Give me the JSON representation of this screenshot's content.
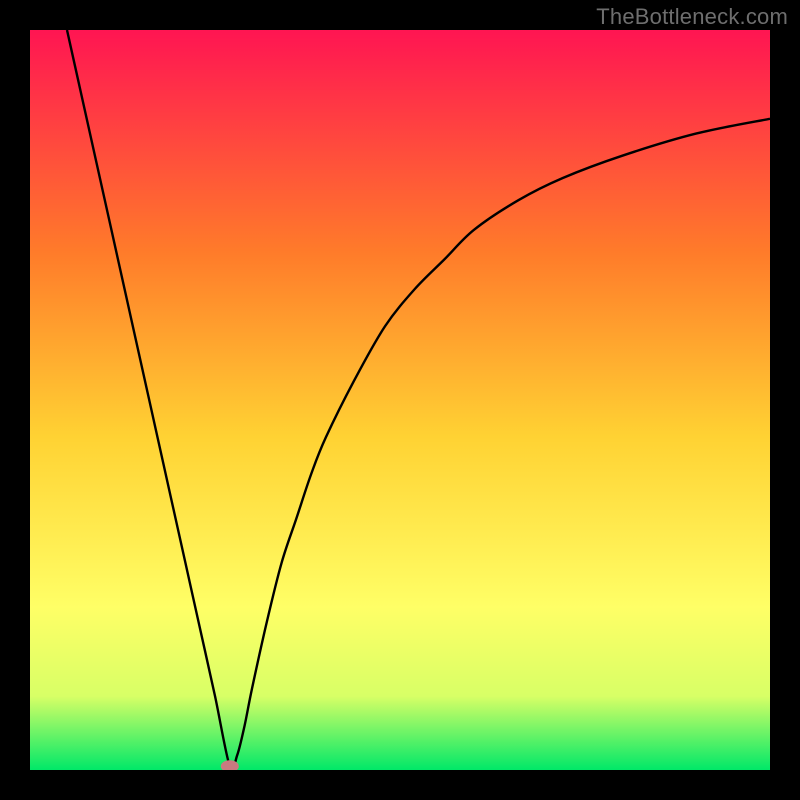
{
  "watermark": "TheBottleneck.com",
  "chart_data": {
    "type": "line",
    "title": "",
    "xlabel": "",
    "ylabel": "",
    "xlim": [
      0,
      100
    ],
    "ylim": [
      0,
      100
    ],
    "background_gradient": {
      "top": "#FF1552",
      "mid_upper": "#FF7B2A",
      "mid": "#FFD233",
      "mid_lower": "#FFFF66",
      "lower": "#D8FF66",
      "bottom": "#00E868"
    },
    "curve_color": "#000000",
    "marker": {
      "x": 27,
      "y": 0.5,
      "color": "#C97A80"
    },
    "series": [
      {
        "name": "bottleneck-curve",
        "x": [
          5,
          7,
          9,
          11,
          13,
          15,
          17,
          19,
          21,
          23,
          25,
          27,
          28,
          29,
          30,
          32,
          34,
          36,
          38,
          40,
          44,
          48,
          52,
          56,
          60,
          66,
          72,
          80,
          90,
          100
        ],
        "y": [
          100,
          91,
          82,
          73,
          64,
          55,
          46,
          37,
          28,
          19,
          10,
          0.5,
          2,
          6,
          11,
          20,
          28,
          34,
          40,
          45,
          53,
          60,
          65,
          69,
          73,
          77,
          80,
          83,
          86,
          88
        ]
      }
    ]
  }
}
